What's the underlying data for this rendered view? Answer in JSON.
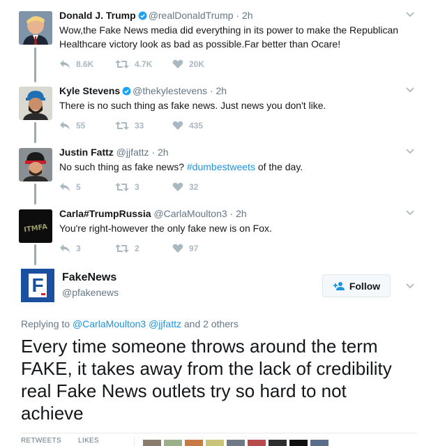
{
  "tweets": [
    {
      "name": "Donald J. Trump",
      "handle": "@realDonaldTrump",
      "time": "· 2h",
      "verified": true,
      "text": "Wow,the Fake News media did everything in its power to make the Republican Healthcare victory look as bad as possible.Far better than Ocare!",
      "replies": "8.6K",
      "retweets": "4.7K",
      "likes": "20K"
    },
    {
      "name": "Kyle Stevens",
      "handle": "@thekylestevens",
      "time": "· 2h",
      "verified": true,
      "text": "There is no such thing as fake news.  Just news you don't like.",
      "replies": "55",
      "retweets": "33",
      "likes": "435"
    },
    {
      "name": "Justin Fattz",
      "handle": "@jjfattz",
      "time": "· 2h",
      "verified": false,
      "text_prefix": "No such thing as fake news? ",
      "hashtag": "#dumbestweets",
      "text_suffix": " of the day.",
      "replies": "5",
      "retweets": "3",
      "likes": "32"
    },
    {
      "name": "Carla#TrumpRussia",
      "handle": "@CarlaMoulton3",
      "time": "· 2h",
      "verified": false,
      "avatar_text": "ITMFA",
      "text": "You're right-however the only fake new is on Fox.",
      "replies": "3",
      "retweets": "2",
      "likes": "97"
    }
  ],
  "main": {
    "name": "FakeNews",
    "handle": "@pfakenews",
    "logo_letter": "F",
    "follow_label": "Follow",
    "replying_prefix": "Replying to ",
    "replying_users": "@CarlaMoulton3 @jjfattz",
    "replying_suffix": " and 2 others",
    "text": "Every time someone throws around the term FAKE, it takes away from the lack of credibility real Fake News outlets try so hard to not achieve",
    "stats_retweets_label": "RETWEETS",
    "stats_likes_label": "LIKES"
  },
  "colors": {
    "link": "#1b95e0",
    "muted": "#657786",
    "action_gray": "#aab8c2",
    "thread_line": "#97aab6",
    "verified": "#1da1f2"
  }
}
